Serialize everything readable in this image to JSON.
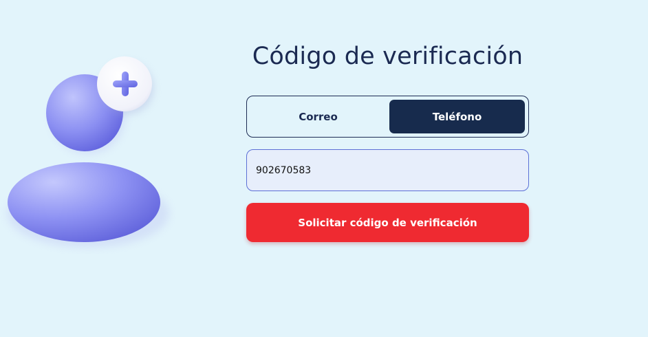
{
  "page": {
    "title": "Código de verificación"
  },
  "tabs": [
    {
      "label": "Correo",
      "active": false
    },
    {
      "label": "Teléfono",
      "active": true
    }
  ],
  "phone_input": {
    "value": "902670583",
    "placeholder": ""
  },
  "submit_button": {
    "label": "Solicitar código de verificación"
  },
  "illustration": {
    "icon": "add-user-icon",
    "colors": {
      "figure_light": "#b4b8fb",
      "figure_dark": "#6466e0",
      "badge": "#ffffff",
      "plus": "#6f74ea"
    }
  },
  "colors": {
    "background": "#e2f4fb",
    "navy": "#172b4d",
    "accent_red": "#ef2a31",
    "input_bg": "#e7eefb",
    "input_border": "#5b6fd6"
  }
}
